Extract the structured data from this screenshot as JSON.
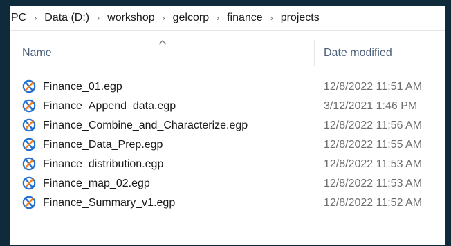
{
  "breadcrumb": {
    "items": [
      "PC",
      "Data (D:)",
      "workshop",
      "gelcorp",
      "finance",
      "projects"
    ]
  },
  "columns": {
    "name": "Name",
    "date_modified": "Date modified"
  },
  "files": [
    {
      "name": "Finance_01.egp",
      "date": "12/8/2022 11:51 AM",
      "icon": "sas-eg-project-icon"
    },
    {
      "name": "Finance_Append_data.egp",
      "date": "3/12/2021 1:46 PM",
      "icon": "sas-eg-project-icon"
    },
    {
      "name": "Finance_Combine_and_Characterize.egp",
      "date": "12/8/2022 11:56 AM",
      "icon": "sas-eg-project-icon"
    },
    {
      "name": "Finance_Data_Prep.egp",
      "date": "12/8/2022 11:55 AM",
      "icon": "sas-eg-project-icon"
    },
    {
      "name": "Finance_distribution.egp",
      "date": "12/8/2022 11:53 AM",
      "icon": "sas-eg-project-icon"
    },
    {
      "name": "Finance_map_02.egp",
      "date": "12/8/2022 11:53 AM",
      "icon": "sas-eg-project-icon"
    },
    {
      "name": "Finance_Summary_v1.egp",
      "date": "12/8/2022 11:52 AM",
      "icon": "sas-eg-project-icon"
    }
  ],
  "colors": {
    "window_background": "#0f2a3a",
    "header_text": "#4c607a",
    "date_text": "#6d6d6d",
    "icon_blue": "#1f6fd1",
    "icon_orange": "#f07d1e"
  }
}
